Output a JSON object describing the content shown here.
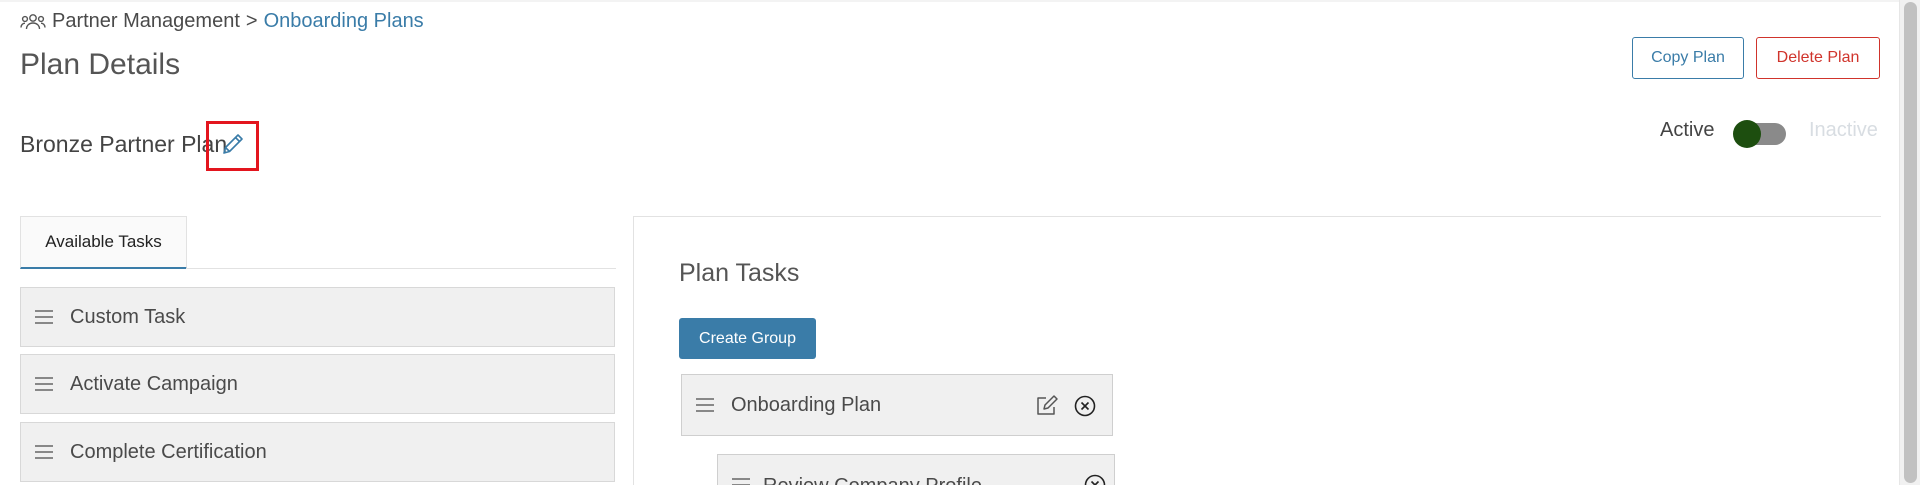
{
  "breadcrumb": {
    "icon": "people-icon",
    "parent": "Partner Management",
    "separator": ">",
    "current": "Onboarding Plans"
  },
  "page": {
    "title": "Plan Details"
  },
  "actions": {
    "copy_label": "Copy Plan",
    "delete_label": "Delete Plan"
  },
  "plan": {
    "name": "Bronze Partner Plan",
    "status_active_label": "Active",
    "status_inactive_label": "Inactive",
    "is_active": true
  },
  "available_tasks": {
    "tab_label": "Available Tasks",
    "items": [
      {
        "label": "Custom Task"
      },
      {
        "label": "Activate Campaign"
      },
      {
        "label": "Complete Certification"
      }
    ]
  },
  "plan_tasks": {
    "title": "Plan Tasks",
    "create_group_label": "Create Group",
    "groups": [
      {
        "label": "Onboarding Plan",
        "tasks": [
          {
            "label": "Review Company Profile"
          }
        ]
      }
    ]
  },
  "colors": {
    "accent": "#3a7ca8",
    "danger": "#d0342c",
    "toggle_knob": "#1d4e0f",
    "highlight": "#e3151e"
  }
}
